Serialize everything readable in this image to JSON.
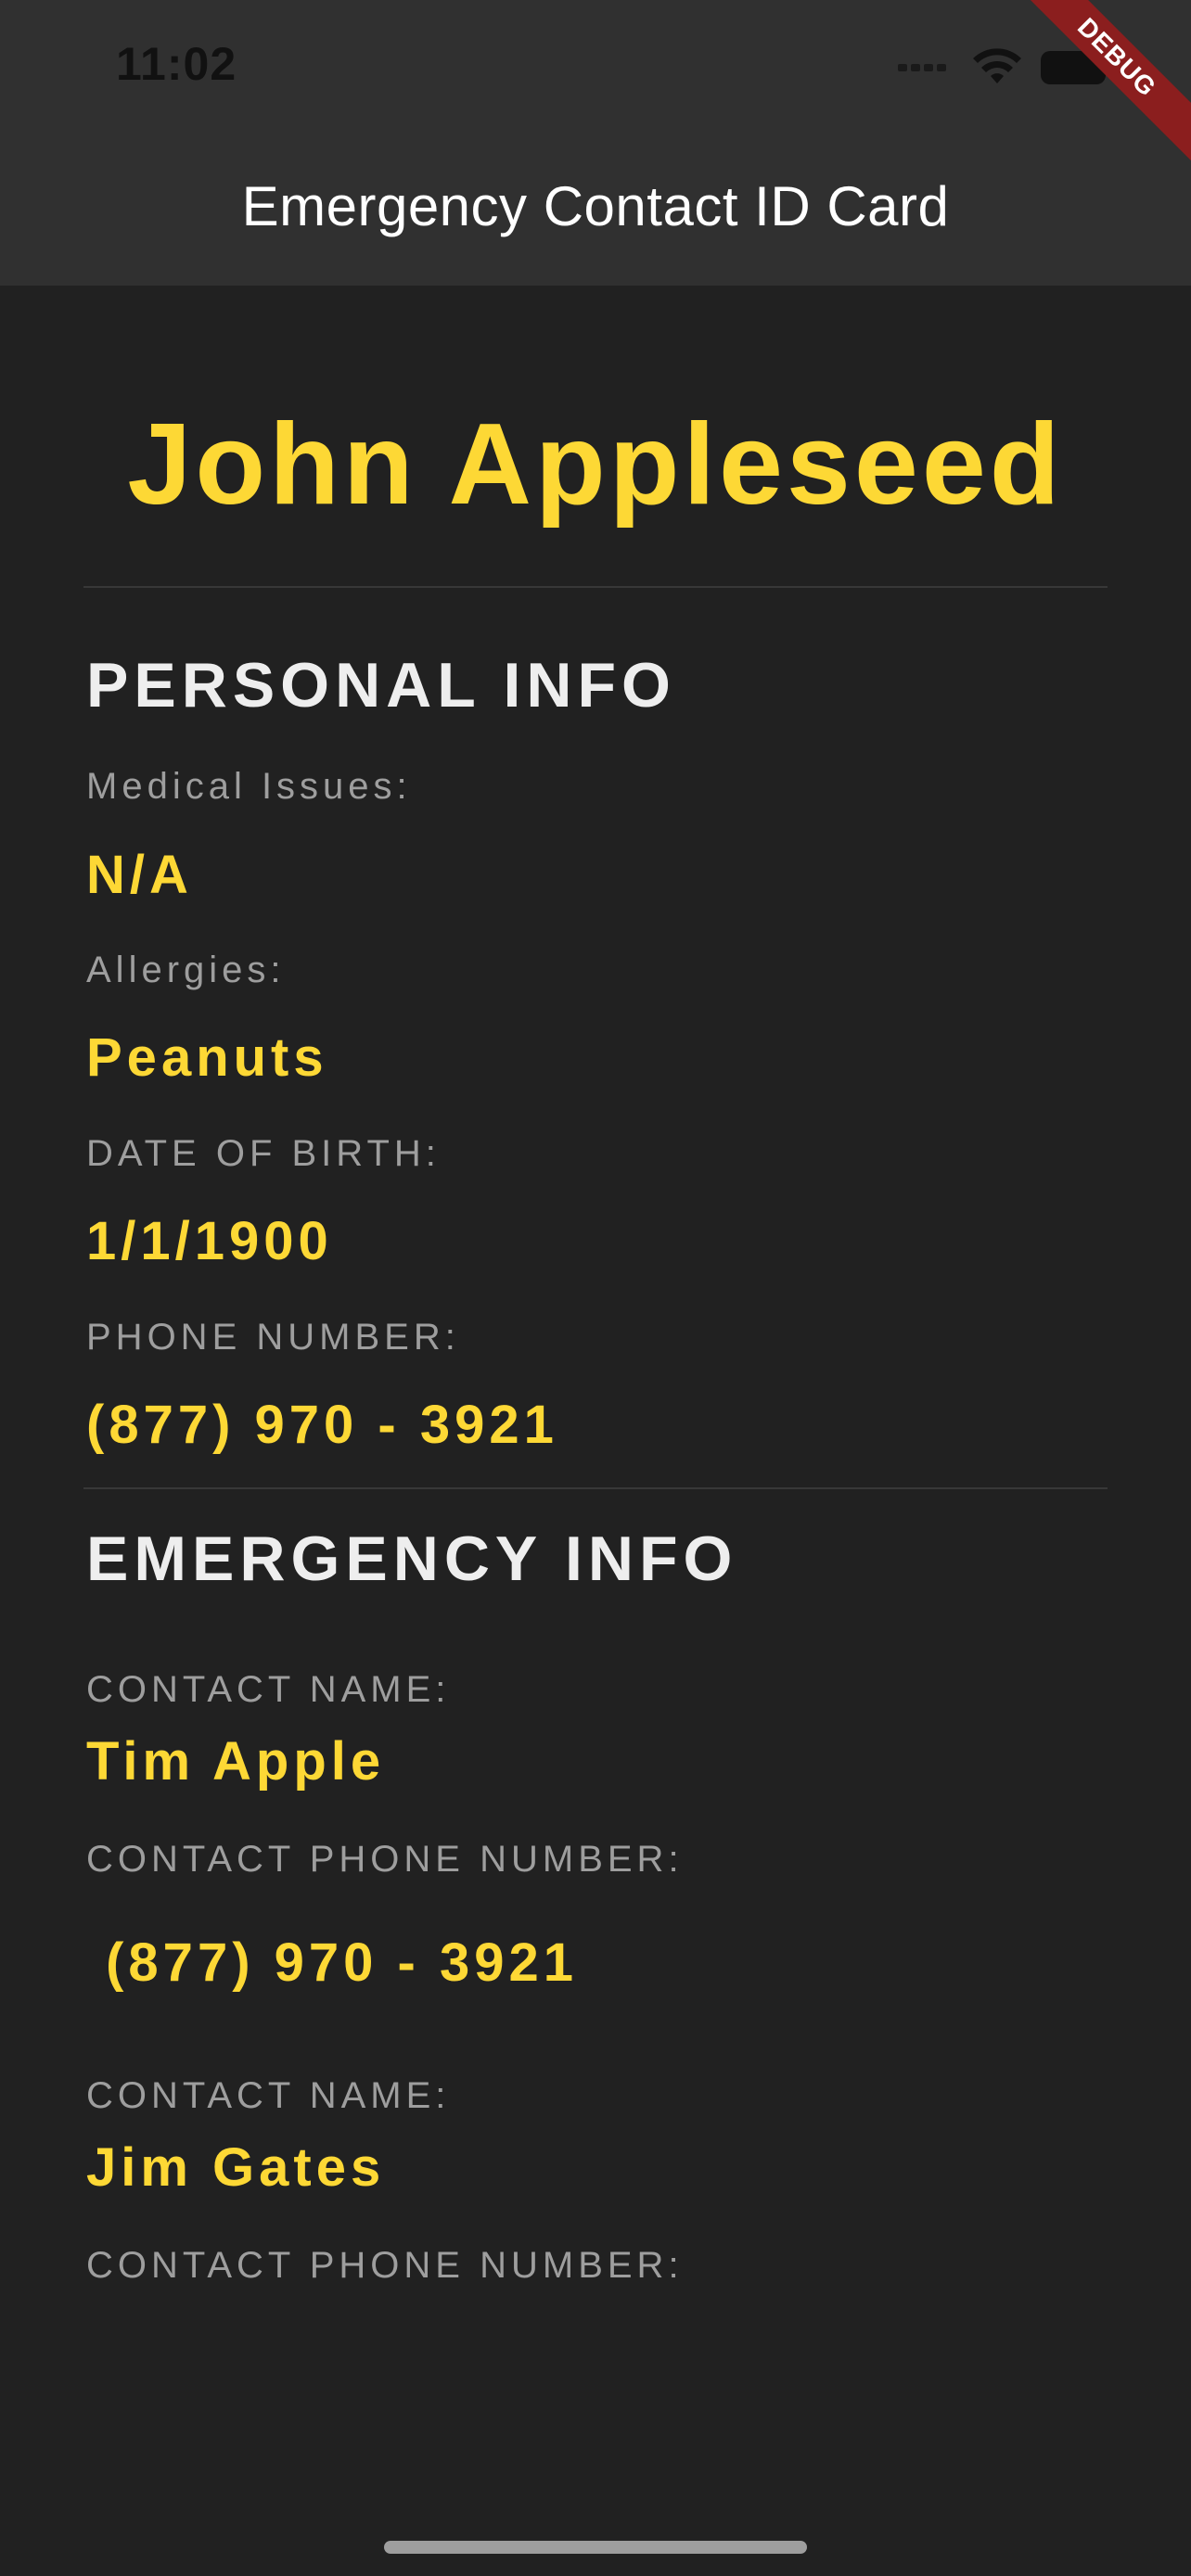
{
  "status_bar": {
    "time": "11:02",
    "icons": [
      "signal-icon",
      "wifi-icon",
      "battery-icon"
    ]
  },
  "debug_banner": "DEBUG",
  "app_bar": {
    "title": "Emergency Contact ID Card"
  },
  "card": {
    "name": "John Appleseed",
    "personal_info": {
      "title": "PERSONAL INFO",
      "fields": [
        {
          "label": "Medical Issues:",
          "value": "N/A"
        },
        {
          "label": "Allergies:",
          "value": "Peanuts"
        },
        {
          "label": "DATE OF BIRTH:",
          "value": "1/1/1900"
        },
        {
          "label": "PHONE NUMBER:",
          "value": "(877) 970 - 3921"
        }
      ]
    },
    "emergency_info": {
      "title": "EMERGENCY INFO",
      "contacts": [
        {
          "name_label": "CONTACT NAME:",
          "name": "Tim Apple",
          "phone_label": "CONTACT PHONE NUMBER:",
          "phone": " (877) 970 - 3921"
        },
        {
          "name_label": "CONTACT NAME:",
          "name": "Jim Gates",
          "phone_label": "CONTACT PHONE NUMBER:",
          "phone": ""
        }
      ]
    }
  },
  "colors": {
    "accent": "#fdd835",
    "background": "#212121",
    "app_bar": "#303030",
    "label": "#9e9e9e",
    "heading": "#eeeeee",
    "debug": "#8b1e1e"
  }
}
